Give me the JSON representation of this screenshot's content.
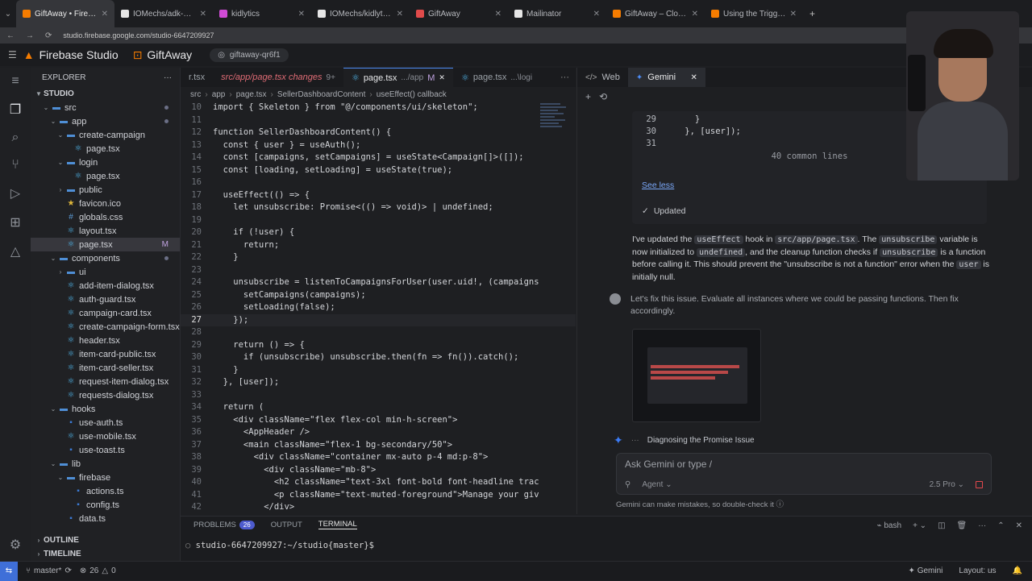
{
  "browser": {
    "tabs": [
      {
        "label": "GiftAway • Firebase Stu",
        "color": "#f57c00",
        "active": true
      },
      {
        "label": "IOMechs/adk-nexus",
        "color": "#e6e6e6"
      },
      {
        "label": "kidlytics",
        "color": "#d04bd6"
      },
      {
        "label": "IOMechs/kidlytics",
        "color": "#e6e6e6"
      },
      {
        "label": "GiftAway",
        "color": "#e04b4b"
      },
      {
        "label": "Mailinator",
        "color": "#e6e6e6"
      },
      {
        "label": "GiftAway – Cloud Fires",
        "color": "#f57c00"
      },
      {
        "label": "Using the Trigger Email",
        "color": "#f57c00"
      }
    ],
    "new_tab": "+",
    "url": "studio.firebase.google.com/studio-6647209927"
  },
  "studio": {
    "brand": "Firebase Studio",
    "project": "GiftAway",
    "workspace_chip": "giftaway-qr6f1"
  },
  "explorer": {
    "title": "EXPLORER",
    "section": "STUDIO",
    "items": [
      {
        "label": "src",
        "depth": 1,
        "type": "folder-open",
        "dot": true
      },
      {
        "label": "app",
        "depth": 2,
        "type": "folder-open",
        "dot": true
      },
      {
        "label": "create-campaign",
        "depth": 3,
        "type": "folder-open"
      },
      {
        "label": "page.tsx",
        "depth": 4,
        "type": "tsx"
      },
      {
        "label": "login",
        "depth": 3,
        "type": "folder-open"
      },
      {
        "label": "page.tsx",
        "depth": 4,
        "type": "tsx"
      },
      {
        "label": "public",
        "depth": 3,
        "type": "folder"
      },
      {
        "label": "favicon.ico",
        "depth": 3,
        "type": "ico"
      },
      {
        "label": "globals.css",
        "depth": 3,
        "type": "css"
      },
      {
        "label": "layout.tsx",
        "depth": 3,
        "type": "tsx"
      },
      {
        "label": "page.tsx",
        "depth": 3,
        "type": "tsx",
        "selected": true,
        "mark": "M"
      },
      {
        "label": "components",
        "depth": 2,
        "type": "folder-open",
        "dot": true
      },
      {
        "label": "ui",
        "depth": 3,
        "type": "folder"
      },
      {
        "label": "add-item-dialog.tsx",
        "depth": 3,
        "type": "tsx"
      },
      {
        "label": "auth-guard.tsx",
        "depth": 3,
        "type": "tsx"
      },
      {
        "label": "campaign-card.tsx",
        "depth": 3,
        "type": "tsx"
      },
      {
        "label": "create-campaign-form.tsx",
        "depth": 3,
        "type": "tsx"
      },
      {
        "label": "header.tsx",
        "depth": 3,
        "type": "tsx"
      },
      {
        "label": "item-card-public.tsx",
        "depth": 3,
        "type": "tsx"
      },
      {
        "label": "item-card-seller.tsx",
        "depth": 3,
        "type": "tsx"
      },
      {
        "label": "request-item-dialog.tsx",
        "depth": 3,
        "type": "tsx"
      },
      {
        "label": "requests-dialog.tsx",
        "depth": 3,
        "type": "tsx"
      },
      {
        "label": "hooks",
        "depth": 2,
        "type": "folder-open"
      },
      {
        "label": "use-auth.ts",
        "depth": 3,
        "type": "ts"
      },
      {
        "label": "use-mobile.tsx",
        "depth": 3,
        "type": "tsx"
      },
      {
        "label": "use-toast.ts",
        "depth": 3,
        "type": "ts"
      },
      {
        "label": "lib",
        "depth": 2,
        "type": "folder-open"
      },
      {
        "label": "firebase",
        "depth": 3,
        "type": "folder-open"
      },
      {
        "label": "actions.ts",
        "depth": 4,
        "type": "ts"
      },
      {
        "label": "config.ts",
        "depth": 4,
        "type": "ts"
      },
      {
        "label": "data.ts",
        "depth": 3,
        "type": "ts"
      }
    ],
    "outline": "OUTLINE",
    "timeline": "TIMELINE"
  },
  "editor": {
    "tabs": [
      {
        "label": "r.tsx",
        "sub": ""
      },
      {
        "label": "src/app/page.tsx changes",
        "sub": "9+",
        "modified": true
      },
      {
        "label": "page.tsx",
        "sub": ".../app",
        "mark": "M",
        "active": true
      },
      {
        "label": "page.tsx",
        "sub": "...\\logi"
      }
    ],
    "breadcrumb": [
      "src",
      "app",
      "page.tsx",
      "SellerDashboardContent",
      "useEffect() callback"
    ],
    "lines": [
      {
        "n": "10",
        "t": "import { Skeleton } from \"@/components/ui/skeleton\";"
      },
      {
        "n": "11",
        "t": ""
      },
      {
        "n": "12",
        "t": "function SellerDashboardContent() {"
      },
      {
        "n": "13",
        "t": "  const { user } = useAuth();"
      },
      {
        "n": "14",
        "t": "  const [campaigns, setCampaigns] = useState<Campaign[]>([]);"
      },
      {
        "n": "15",
        "t": "  const [loading, setLoading] = useState(true);"
      },
      {
        "n": "16",
        "t": ""
      },
      {
        "n": "17",
        "t": "  useEffect(() => {"
      },
      {
        "n": "18",
        "t": "    let unsubscribe: Promise<(() => void)> | undefined;"
      },
      {
        "n": "19",
        "t": ""
      },
      {
        "n": "20",
        "t": "    if (!user) {"
      },
      {
        "n": "21",
        "t": "      return;"
      },
      {
        "n": "22",
        "t": "    }"
      },
      {
        "n": "23",
        "t": ""
      },
      {
        "n": "24",
        "t": "    unsubscribe = listenToCampaignsForUser(user.uid!, (campaigns"
      },
      {
        "n": "25",
        "t": "      setCampaigns(campaigns);"
      },
      {
        "n": "26",
        "t": "      setLoading(false);"
      },
      {
        "n": "27",
        "t": "    });",
        "current": true
      },
      {
        "n": "28",
        "t": ""
      },
      {
        "n": "29",
        "t": "    return () => {"
      },
      {
        "n": "30",
        "t": "      if (unsubscribe) unsubscribe.then(fn => fn()).catch();"
      },
      {
        "n": "31",
        "t": "    }"
      },
      {
        "n": "32",
        "t": "  }, [user]);"
      },
      {
        "n": "33",
        "t": ""
      },
      {
        "n": "34",
        "t": "  return ("
      },
      {
        "n": "35",
        "t": "    <div className=\"flex flex-col min-h-screen\">"
      },
      {
        "n": "36",
        "t": "      <AppHeader />"
      },
      {
        "n": "37",
        "t": "      <main className=\"flex-1 bg-secondary/50\">"
      },
      {
        "n": "38",
        "t": "        <div className=\"container mx-auto p-4 md:p-8\">"
      },
      {
        "n": "39",
        "t": "          <div className=\"mb-8\">"
      },
      {
        "n": "40",
        "t": "            <h2 className=\"text-3xl font-bold font-headline trac"
      },
      {
        "n": "41",
        "t": "            <p className=\"text-muted-foreground\">Manage your giv"
      },
      {
        "n": "42",
        "t": "          </div>"
      }
    ]
  },
  "gemini": {
    "tabs": [
      {
        "label": "Web",
        "icon": "code-icon"
      },
      {
        "label": "Gemini",
        "icon": "sparkle-icon",
        "active": true
      }
    ],
    "diff_lines": [
      {
        "n": "29",
        "t": "      }"
      },
      {
        "n": "30",
        "t": "    }, [user]);"
      },
      {
        "n": "31",
        "t": ""
      }
    ],
    "common_lines": "40 common lines",
    "see_less": "See less",
    "updated": "Updated",
    "reply": {
      "p1": "I've updated the ",
      "c1": "useEffect",
      "p2": " hook in ",
      "c2": "src/app/page.tsx",
      "p3": ". The ",
      "c3": "unsubscribe",
      "p4": " variable is now initialized to ",
      "c4": "undefined",
      "p5": ", and the cleanup function checks if ",
      "c5": "unsubscribe",
      "p6": " is a function before calling it. This should prevent the \"unsubscribe is not a function\" error when the ",
      "c6": "user",
      "p7": " is initially null."
    },
    "user_message": "Let's fix this issue. Evaluate all instances where we could be passing functions. Then fix accordingly.",
    "status": "Diagnosing the Promise Issue",
    "ask_placeholder": "Ask Gemini or type /",
    "agent_label": "Agent",
    "model_label": "2.5 Pro",
    "disclaimer": "Gemini can make mistakes, so double-check it"
  },
  "panel": {
    "tabs": [
      {
        "label": "PROBLEMS",
        "badge": "26"
      },
      {
        "label": "OUTPUT"
      },
      {
        "label": "TERMINAL",
        "active": true
      }
    ],
    "shell": "bash",
    "prompt": "studio-6647209927:~/studio{master}$"
  },
  "statusbar": {
    "branch": "master*",
    "errors": "26",
    "warnings": "0",
    "gemini": "Gemini",
    "layout": "Layout: us"
  },
  "colors": {
    "accent": "#3f6fd8",
    "firebase": "#f57c00"
  }
}
